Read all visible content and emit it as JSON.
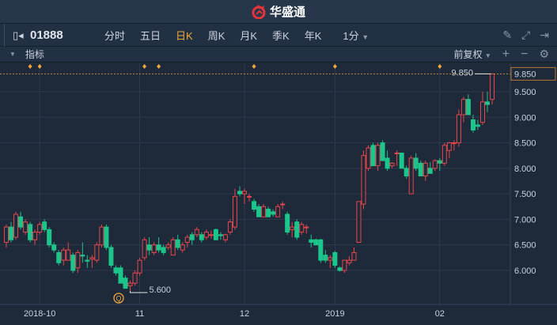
{
  "app": {
    "title": "华盛通",
    "logo_color": "#e6343a"
  },
  "toolbar": {
    "code": "01888",
    "tabs": [
      {
        "label": "分时"
      },
      {
        "label": "五日"
      },
      {
        "label": "日K",
        "active": true
      },
      {
        "label": "周K"
      },
      {
        "label": "月K"
      },
      {
        "label": "季K"
      },
      {
        "label": "年K"
      }
    ],
    "interval": "1分",
    "icons": [
      "pencil-icon",
      "fullscreen-icon",
      "sidebar-toggle-icon"
    ]
  },
  "indicator_bar": {
    "label": "指标",
    "adjust": "前复权",
    "icons": [
      "plus-icon",
      "minus-icon",
      "gear-icon"
    ]
  },
  "colors": {
    "up": "#e8474d",
    "down": "#1cc58b",
    "grid": "#2d3b4f",
    "accent": "#f0a93a"
  },
  "chart_data": {
    "type": "candlestick",
    "ylim": [
      5.5,
      9.95
    ],
    "y_ticks": [
      "6.000",
      "6.500",
      "7.000",
      "7.500",
      "8.000",
      "8.500",
      "9.000",
      "9.500"
    ],
    "y_tick_values": [
      6.0,
      6.5,
      7.0,
      7.5,
      8.0,
      8.5,
      9.0,
      9.5
    ],
    "x_labels": [
      {
        "label": "2018-10",
        "index": 7
      },
      {
        "label": "11",
        "index": 28
      },
      {
        "label": "12",
        "index": 50
      },
      {
        "label": "2019",
        "index": 69
      },
      {
        "label": "02",
        "index": 91
      }
    ],
    "event_marker_indices": [
      5,
      7,
      29,
      32,
      52,
      69,
      91
    ],
    "current_price": "9.850",
    "current_price_value": 9.85,
    "max_label": "9.850",
    "min_label": "5.600",
    "min_value": 5.6,
    "min_index": 26,
    "ohlc": [
      [
        6.55,
        6.9,
        6.45,
        6.85
      ],
      [
        6.85,
        6.95,
        6.55,
        6.6
      ],
      [
        6.65,
        7.15,
        6.6,
        7.1
      ],
      [
        7.05,
        7.15,
        6.8,
        6.85
      ],
      [
        6.75,
        7.0,
        6.7,
        6.95
      ],
      [
        6.9,
        6.95,
        6.55,
        6.6
      ],
      [
        6.6,
        6.8,
        6.5,
        6.75
      ],
      [
        6.75,
        6.95,
        6.7,
        6.9
      ],
      [
        6.95,
        7.0,
        6.75,
        6.8
      ],
      [
        6.8,
        6.85,
        6.45,
        6.5
      ],
      [
        6.5,
        6.55,
        6.35,
        6.4
      ],
      [
        6.35,
        6.4,
        6.1,
        6.15
      ],
      [
        6.2,
        6.45,
        6.1,
        6.4
      ],
      [
        6.2,
        6.55,
        6.2,
        6.4
      ],
      [
        6.3,
        6.35,
        5.95,
        6.0
      ],
      [
        6.05,
        6.4,
        5.95,
        6.35
      ],
      [
        6.3,
        6.55,
        6.15,
        6.28
      ],
      [
        6.2,
        6.3,
        6.05,
        6.18
      ],
      [
        6.22,
        6.3,
        6.05,
        6.25
      ],
      [
        6.2,
        6.55,
        6.15,
        6.5
      ],
      [
        6.5,
        6.9,
        6.45,
        6.85
      ],
      [
        6.85,
        6.9,
        6.4,
        6.45
      ],
      [
        6.45,
        6.5,
        6.05,
        6.1
      ],
      [
        6.05,
        6.1,
        5.9,
        5.95
      ],
      [
        6.05,
        6.1,
        5.75,
        5.75
      ],
      [
        5.85,
        5.9,
        5.65,
        5.65
      ],
      [
        5.7,
        5.8,
        5.6,
        5.75
      ],
      [
        5.75,
        6.0,
        5.7,
        5.95
      ],
      [
        5.95,
        6.25,
        5.9,
        6.2
      ],
      [
        6.25,
        6.65,
        6.2,
        6.6
      ],
      [
        6.5,
        6.65,
        6.3,
        6.4
      ],
      [
        6.35,
        6.55,
        6.3,
        6.5
      ],
      [
        6.5,
        6.65,
        6.35,
        6.4
      ],
      [
        6.45,
        6.5,
        6.3,
        6.35
      ],
      [
        6.45,
        6.55,
        6.4,
        6.5
      ],
      [
        6.3,
        6.65,
        6.3,
        6.6
      ],
      [
        6.6,
        6.7,
        6.4,
        6.45
      ],
      [
        6.4,
        6.55,
        6.35,
        6.5
      ],
      [
        6.55,
        6.7,
        6.45,
        6.65
      ],
      [
        6.7,
        6.75,
        6.5,
        6.6
      ],
      [
        6.7,
        6.85,
        6.65,
        6.8
      ],
      [
        6.7,
        6.75,
        6.55,
        6.6
      ],
      [
        6.65,
        6.8,
        6.6,
        6.75
      ],
      [
        6.7,
        6.78,
        6.62,
        6.7
      ],
      [
        6.8,
        6.82,
        6.6,
        6.6
      ],
      [
        6.7,
        6.75,
        6.6,
        6.68
      ],
      [
        6.6,
        6.72,
        6.55,
        6.7
      ],
      [
        6.75,
        7.0,
        6.7,
        6.95
      ],
      [
        6.85,
        7.6,
        6.8,
        7.45
      ],
      [
        7.55,
        7.65,
        7.45,
        7.5
      ],
      [
        7.5,
        7.6,
        7.3,
        7.55
      ],
      [
        7.45,
        7.5,
        7.35,
        7.45
      ],
      [
        7.35,
        7.4,
        7.15,
        7.2
      ],
      [
        7.25,
        7.3,
        7.1,
        7.05
      ],
      [
        7.05,
        7.3,
        7.05,
        7.25
      ],
      [
        7.2,
        7.25,
        7.05,
        7.05
      ],
      [
        7.15,
        7.2,
        7.05,
        7.1
      ],
      [
        7.05,
        7.3,
        7.05,
        7.25
      ],
      [
        7.3,
        7.35,
        7.2,
        7.3
      ],
      [
        7.1,
        7.15,
        6.7,
        6.75
      ],
      [
        6.8,
        6.95,
        6.65,
        6.85
      ],
      [
        6.95,
        7.0,
        6.6,
        6.65
      ],
      [
        6.75,
        6.95,
        6.7,
        6.9
      ],
      [
        6.85,
        6.9,
        6.72,
        6.85
      ],
      [
        6.6,
        6.7,
        6.45,
        6.55
      ],
      [
        6.6,
        6.62,
        6.5,
        6.5
      ],
      [
        6.6,
        6.62,
        6.15,
        6.2
      ],
      [
        6.3,
        6.4,
        6.15,
        6.2
      ],
      [
        6.2,
        6.3,
        6.05,
        6.25
      ],
      [
        6.35,
        6.38,
        6.05,
        6.1
      ],
      [
        6.05,
        6.08,
        5.98,
        6.0
      ],
      [
        6.0,
        6.2,
        5.95,
        6.2
      ],
      [
        6.15,
        6.28,
        6.1,
        6.2
      ],
      [
        6.2,
        6.45,
        6.2,
        6.35
      ],
      [
        6.55,
        7.35,
        6.55,
        7.35
      ],
      [
        7.3,
        8.35,
        7.2,
        8.25
      ],
      [
        8.0,
        8.45,
        7.95,
        8.4
      ],
      [
        8.45,
        8.5,
        8.05,
        8.05
      ],
      [
        8.05,
        8.5,
        7.95,
        8.45
      ],
      [
        8.5,
        8.55,
        8.15,
        8.15
      ],
      [
        8.2,
        8.35,
        7.95,
        8.0
      ],
      [
        8.05,
        8.12,
        8.0,
        8.1
      ],
      [
        8.3,
        8.35,
        8.05,
        8.3
      ],
      [
        8.3,
        8.3,
        8.0,
        8.0
      ],
      [
        8.0,
        8.05,
        7.8,
        7.85
      ],
      [
        7.5,
        8.25,
        7.5,
        8.2
      ],
      [
        8.2,
        8.3,
        7.95,
        8.0
      ],
      [
        8.1,
        8.15,
        7.85,
        7.85
      ],
      [
        7.85,
        8.15,
        7.75,
        8.1
      ],
      [
        8.0,
        8.12,
        7.9,
        7.9
      ],
      [
        8.0,
        8.18,
        7.95,
        8.15
      ],
      [
        8.15,
        8.2,
        7.95,
        8.1
      ],
      [
        8.1,
        8.5,
        8.05,
        8.45
      ],
      [
        8.35,
        8.52,
        8.2,
        8.5
      ],
      [
        8.5,
        8.55,
        8.35,
        8.5
      ],
      [
        8.5,
        9.15,
        8.42,
        9.05
      ],
      [
        9.05,
        9.4,
        8.9,
        9.35
      ],
      [
        9.35,
        9.45,
        9.05,
        9.05
      ],
      [
        8.95,
        9.05,
        8.7,
        8.75
      ],
      [
        8.85,
        8.95,
        8.75,
        8.82
      ],
      [
        8.9,
        9.5,
        8.85,
        9.3
      ],
      [
        9.3,
        9.5,
        9.1,
        9.25
      ],
      [
        9.35,
        9.85,
        9.25,
        9.85
      ]
    ]
  }
}
